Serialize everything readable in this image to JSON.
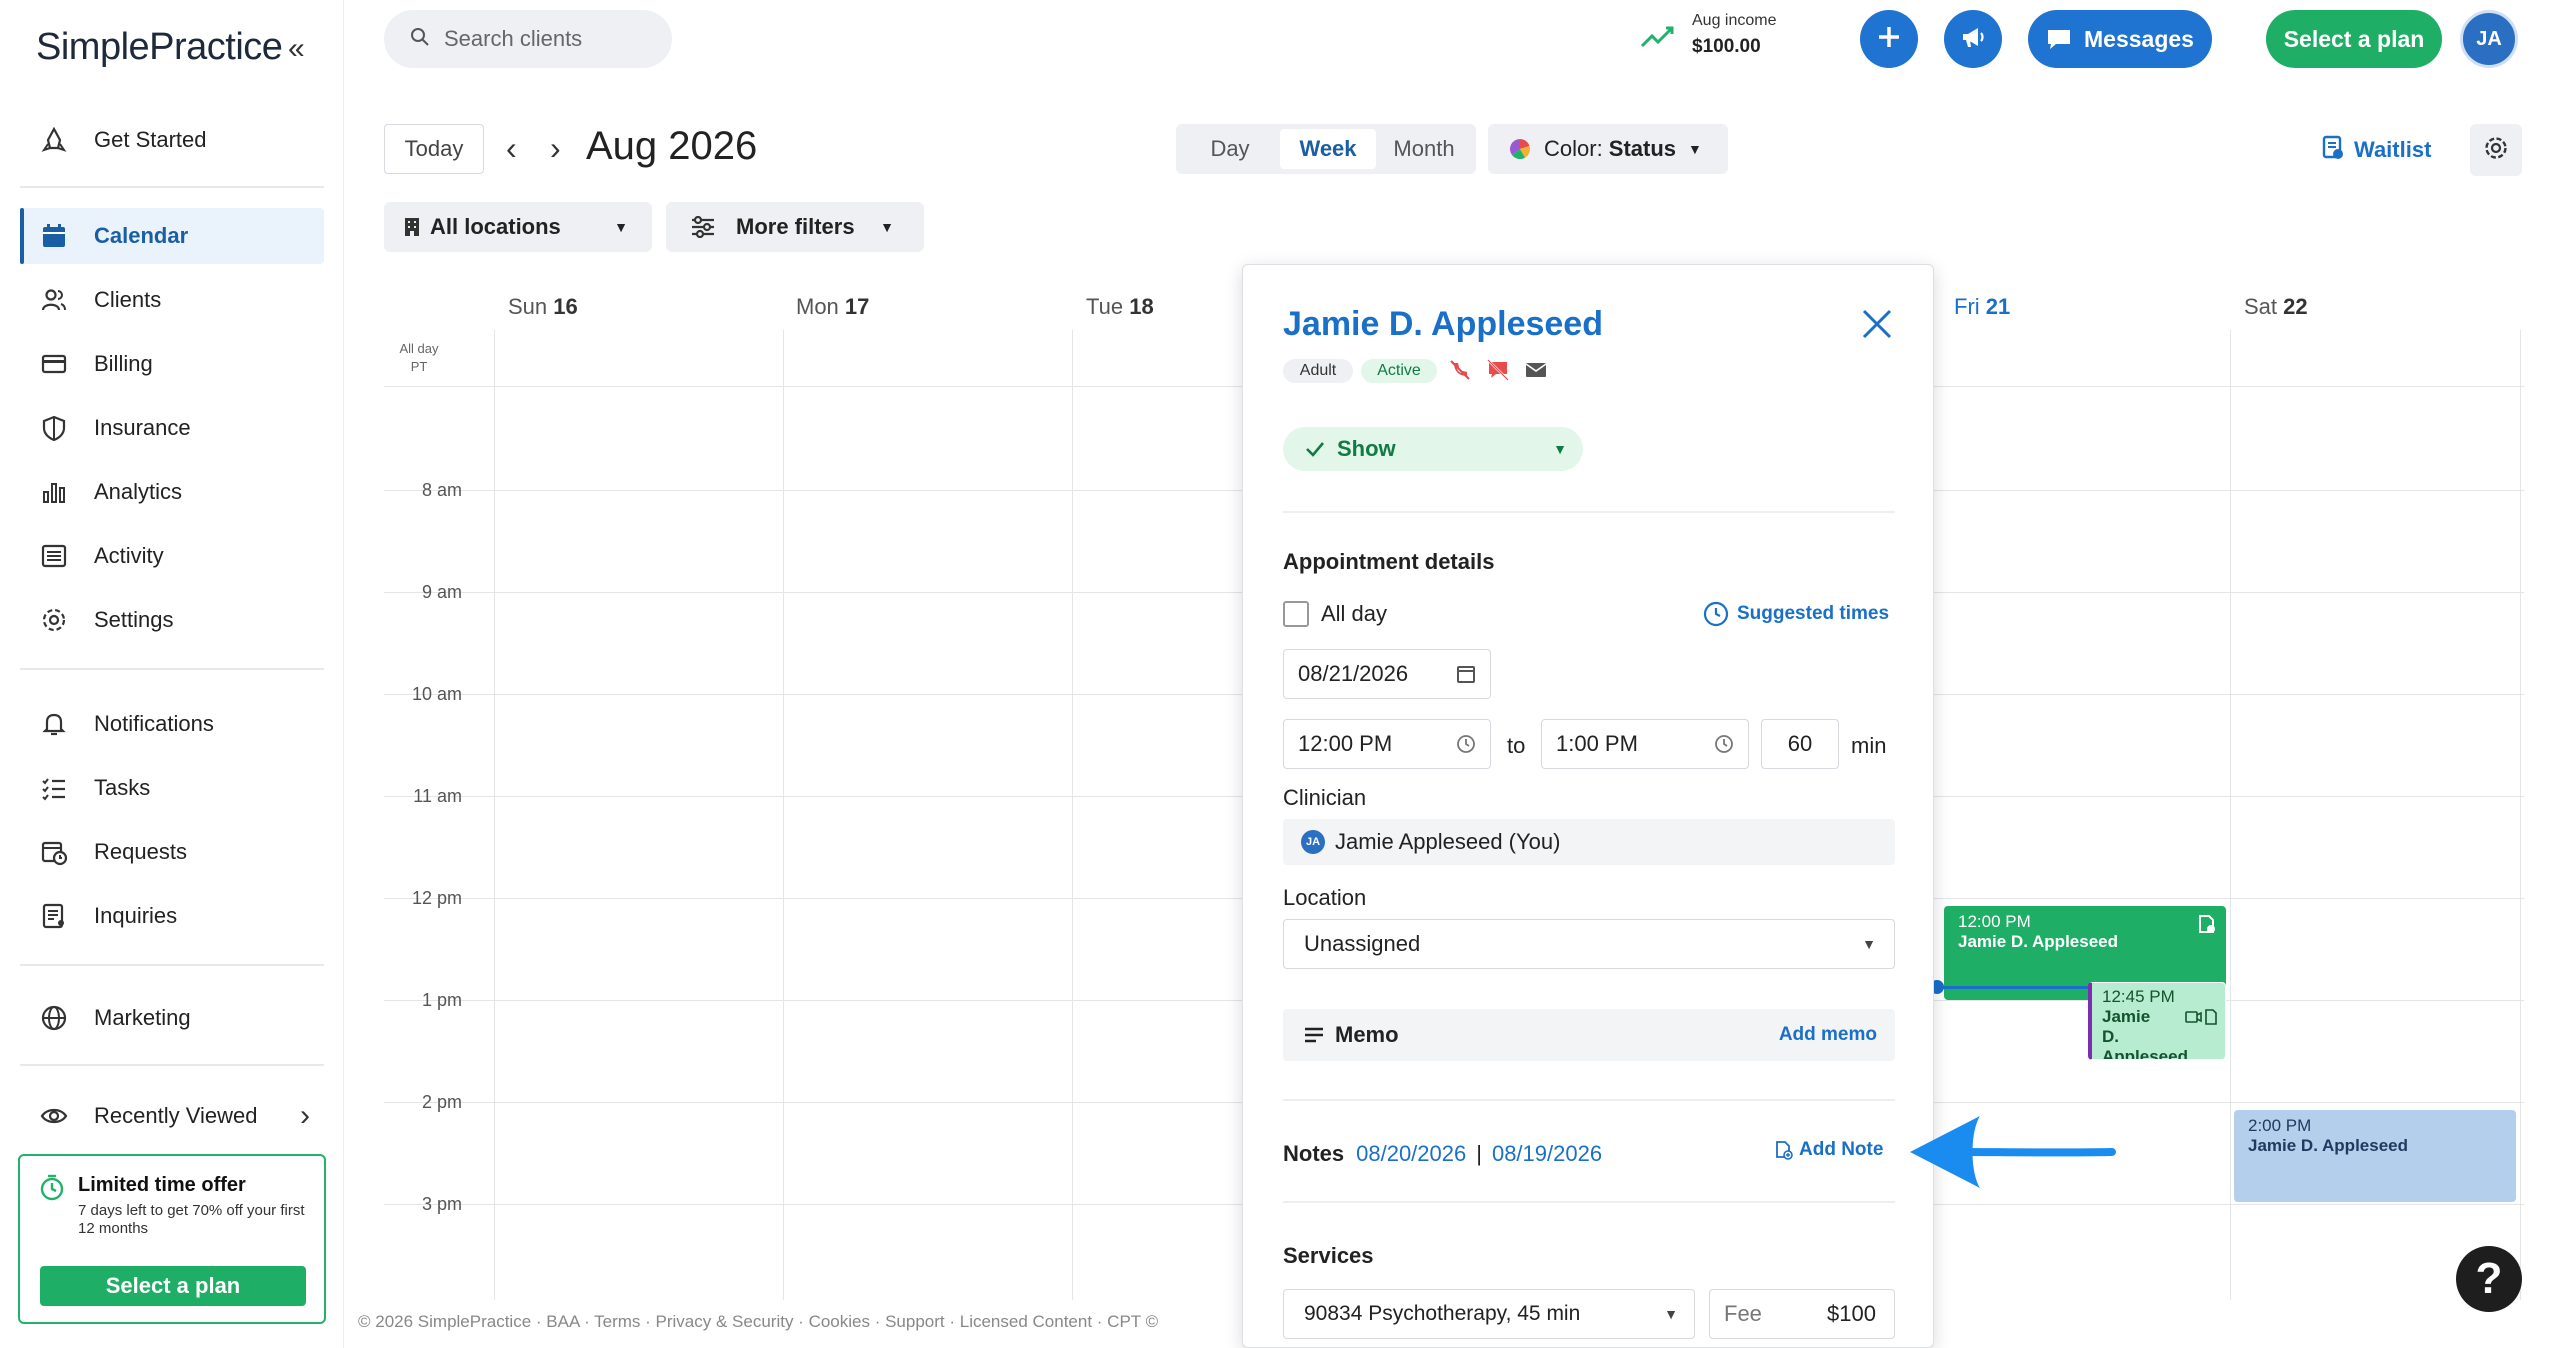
{
  "brand": {
    "logo": "SimplePractice"
  },
  "sidebar": {
    "items": [
      {
        "label": "Get Started",
        "icon": "rocket-icon"
      },
      {
        "label": "Calendar",
        "icon": "calendar-icon",
        "active": true
      },
      {
        "label": "Clients",
        "icon": "users-icon"
      },
      {
        "label": "Billing",
        "icon": "credit-card-icon"
      },
      {
        "label": "Insurance",
        "icon": "shield-icon"
      },
      {
        "label": "Analytics",
        "icon": "bar-chart-icon"
      },
      {
        "label": "Activity",
        "icon": "list-icon"
      },
      {
        "label": "Settings",
        "icon": "gear-icon"
      },
      {
        "label": "Notifications",
        "icon": "bell-icon"
      },
      {
        "label": "Tasks",
        "icon": "checklist-icon"
      },
      {
        "label": "Requests",
        "icon": "calendar-clock-icon"
      },
      {
        "label": "Inquiries",
        "icon": "inbox-icon"
      },
      {
        "label": "Marketing",
        "icon": "globe-icon"
      },
      {
        "label": "Recently Viewed",
        "icon": "eye-icon"
      }
    ],
    "offer": {
      "title": "Limited time offer",
      "subtitle": "7 days left to get 70% off your first 12 months",
      "button": "Select a plan"
    }
  },
  "topbar": {
    "search_placeholder": "Search clients",
    "income_label": "Aug income",
    "income_value": "$100.00",
    "messages_label": "Messages",
    "plan_label": "Select a plan",
    "avatar_initials": "JA"
  },
  "toolbar": {
    "today": "Today",
    "period": "Aug 2026",
    "views": [
      "Day",
      "Week",
      "Month"
    ],
    "active_view": "Week",
    "color_prefix": "Color: ",
    "color_value": "Status",
    "waitlist": "Waitlist",
    "locations": "All locations",
    "more_filters": "More filters"
  },
  "calendar": {
    "days": [
      {
        "dow": "Sun",
        "num": "16"
      },
      {
        "dow": "Mon",
        "num": "17"
      },
      {
        "dow": "Tue",
        "num": "18"
      },
      {
        "dow": "Fri",
        "num": "21"
      },
      {
        "dow": "Sat",
        "num": "22"
      }
    ],
    "allday_label": "All day",
    "tz_label": "PT",
    "hours": [
      "8 am",
      "9 am",
      "10 am",
      "11 am",
      "12 pm",
      "1 pm",
      "2 pm",
      "3 pm"
    ],
    "events": [
      {
        "time": "12:00 PM",
        "name": "Jamie D. Appleseed"
      },
      {
        "time": "12:45 PM",
        "name": "Jamie D. Appleseed"
      },
      {
        "time": "2:00 PM",
        "name": "Jamie D. Appleseed"
      }
    ]
  },
  "popover": {
    "client_name": "Jamie D. Appleseed",
    "tags": [
      "Adult",
      "Active"
    ],
    "status": "Show",
    "section_title": "Appointment details",
    "allday_label": "All day",
    "suggested_times": "Suggested times",
    "date": "08/21/2026",
    "start_time": "12:00 PM",
    "to_label": "to",
    "end_time": "1:00 PM",
    "duration": "60",
    "duration_unit": "min",
    "clinician_label": "Clinician",
    "clinician_initials": "JA",
    "clinician_value": "Jamie Appleseed (You)",
    "location_label": "Location",
    "location_value": "Unassigned",
    "memo_label": "Memo",
    "add_memo": "Add memo",
    "notes_label": "Notes",
    "note_date_1": "08/20/2026",
    "note_sep": "|",
    "note_date_2": "08/19/2026",
    "add_note": "Add Note",
    "services_label": "Services",
    "service_value": "90834 Psychotherapy, 45 min",
    "fee_label": "Fee",
    "fee_value": "$100"
  },
  "footer": "© 2026 SimplePractice · BAA · Terms · Privacy & Security · Cookies · Support · Licensed Content · CPT ©",
  "help": "?",
  "colors": {
    "brand_blue": "#1a6fc9",
    "green": "#1fae66",
    "event_green": "#21b26b",
    "event_blue": "#b3cfec"
  }
}
